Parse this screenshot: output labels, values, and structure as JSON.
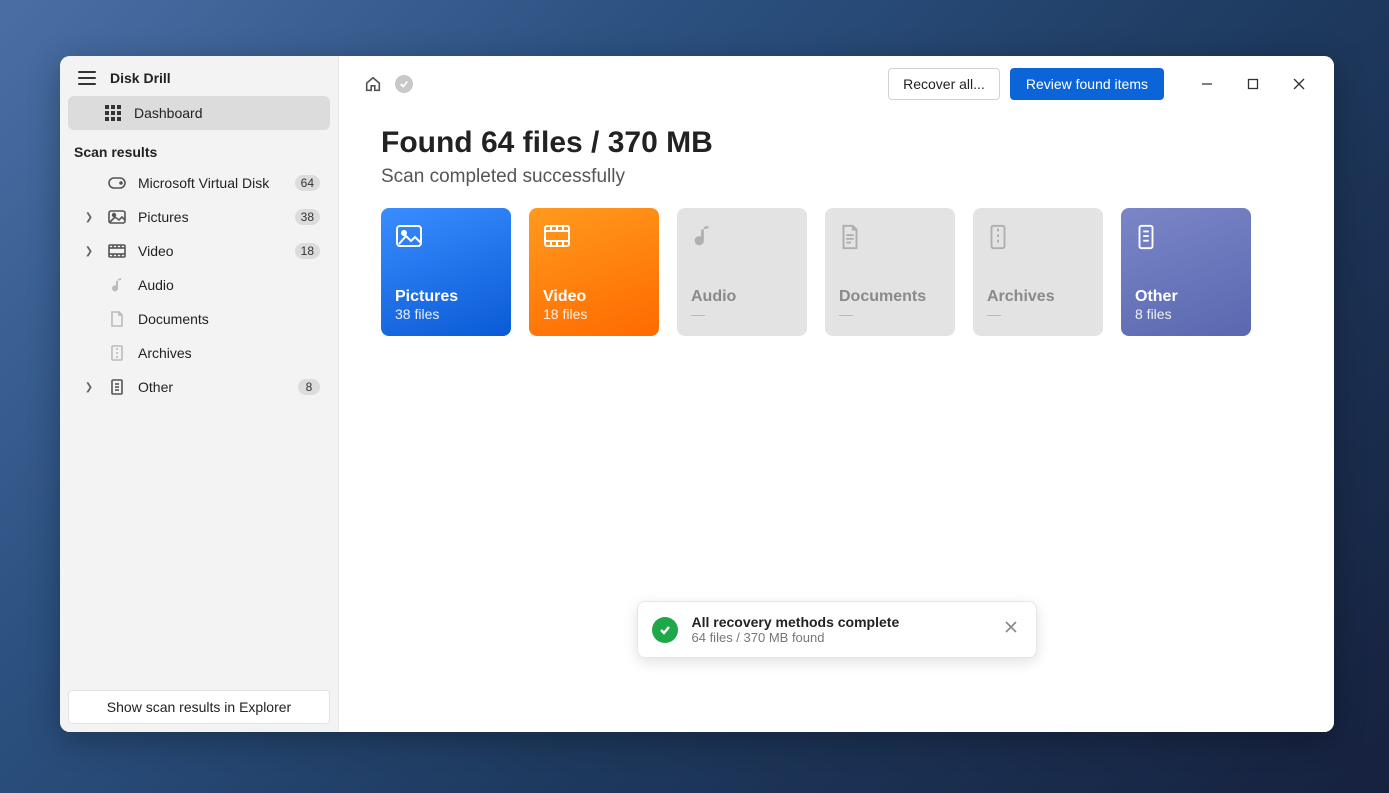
{
  "app": {
    "title": "Disk Drill"
  },
  "sidebar": {
    "dashboard_label": "Dashboard",
    "scan_results_heading": "Scan results",
    "items": [
      {
        "label": "Microsoft Virtual Disk",
        "badge": "64"
      },
      {
        "label": "Pictures",
        "badge": "38"
      },
      {
        "label": "Video",
        "badge": "18"
      },
      {
        "label": "Audio",
        "badge": ""
      },
      {
        "label": "Documents",
        "badge": ""
      },
      {
        "label": "Archives",
        "badge": ""
      },
      {
        "label": "Other",
        "badge": "8"
      }
    ],
    "footer_button": "Show scan results in Explorer"
  },
  "toolbar": {
    "recover_label": "Recover all...",
    "review_label": "Review found items"
  },
  "main": {
    "headline": "Found 64 files / 370 MB",
    "subline": "Scan completed successfully"
  },
  "cards": {
    "pictures": {
      "title": "Pictures",
      "sub": "38 files"
    },
    "video": {
      "title": "Video",
      "sub": "18 files"
    },
    "audio": {
      "title": "Audio",
      "sub": "—"
    },
    "documents": {
      "title": "Documents",
      "sub": "—"
    },
    "archives": {
      "title": "Archives",
      "sub": "—"
    },
    "other": {
      "title": "Other",
      "sub": "8 files"
    }
  },
  "toast": {
    "title": "All recovery methods complete",
    "sub": "64 files / 370 MB found"
  }
}
